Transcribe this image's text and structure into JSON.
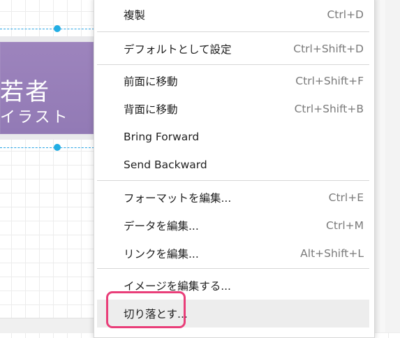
{
  "canvas": {
    "image_text_line1": "若者",
    "image_text_line2": "イラスト"
  },
  "menu": {
    "items": [
      {
        "label": "複製",
        "shortcut": "Ctrl+D"
      },
      {
        "label": "デフォルトとして設定",
        "shortcut": "Ctrl+Shift+D"
      },
      {
        "label": "前面に移動",
        "shortcut": "Ctrl+Shift+F"
      },
      {
        "label": "背面に移動",
        "shortcut": "Ctrl+Shift+B"
      },
      {
        "label": "Bring Forward",
        "shortcut": ""
      },
      {
        "label": "Send Backward",
        "shortcut": ""
      },
      {
        "label": "フォーマットを編集...",
        "shortcut": "Ctrl+E"
      },
      {
        "label": "データを編集...",
        "shortcut": "Ctrl+M"
      },
      {
        "label": "リンクを編集...",
        "shortcut": "Alt+Shift+L"
      },
      {
        "label": "イメージを編集する...",
        "shortcut": ""
      },
      {
        "label": "切り落とす...",
        "shortcut": ""
      }
    ]
  },
  "colors": {
    "selection": "#27a3e5",
    "highlight": "#e93e79",
    "ribbon": "#9d84bd"
  }
}
